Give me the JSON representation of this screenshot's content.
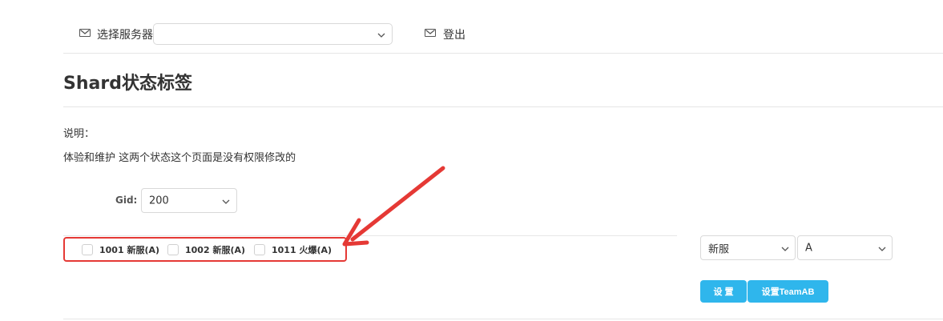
{
  "header": {
    "server_label": "选择服务器",
    "server_value": "",
    "logout_label": "登出"
  },
  "page": {
    "title": "Shard状态标签"
  },
  "notes": {
    "heading": "说明：",
    "text": "体验和维护 这两个状态这个页面是没有权限修改的"
  },
  "gid": {
    "label": "Gid:",
    "value": "200"
  },
  "shards": [
    {
      "label": "1001 新服(A)",
      "checked": false
    },
    {
      "label": "1002 新服(A)",
      "checked": false
    },
    {
      "label": "1011 火爆(A)",
      "checked": false
    }
  ],
  "status_select": {
    "value": "新服"
  },
  "team_select": {
    "value": "A"
  },
  "buttons": {
    "set_label": "设 置",
    "set_team_label": "设置TeamAB"
  },
  "colors": {
    "accent": "#2fb6ec",
    "annotation": "#e53935",
    "border": "#d9d9d9",
    "divider": "#e6e6e6"
  },
  "icons": {
    "server": "mail-icon",
    "logout": "mail-icon",
    "dropdown": "chevron-down-icon"
  }
}
